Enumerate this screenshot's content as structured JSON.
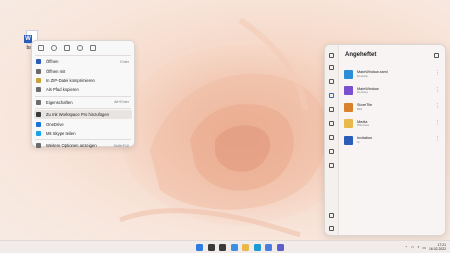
{
  "desktop": {
    "icon_label": "babo"
  },
  "context_menu": {
    "toolbar_icons": [
      "cut-icon",
      "copy-icon",
      "rename-icon",
      "share-icon",
      "delete-icon"
    ],
    "items": [
      {
        "label": "Öffnen",
        "shortcut": "Enter",
        "icon": "word-icon",
        "color": "#2b5cb8"
      },
      {
        "label": "Öffnen mit",
        "shortcut": "",
        "icon": "open-with-icon",
        "color": "#6b6b6b"
      },
      {
        "label": "In ZIP-Datei komprimieren",
        "shortcut": "",
        "icon": "zip-icon",
        "color": "#c9a23a"
      },
      {
        "label": "Als Pfad kopieren",
        "shortcut": "",
        "icon": "path-icon",
        "color": "#6b6b6b"
      },
      {
        "label": "Eigenschaften",
        "shortcut": "Alt+Enter",
        "icon": "properties-icon",
        "color": "#6b6b6b"
      },
      {
        "label": "Zu Ink Workspace Pro hinzufügen",
        "shortcut": "",
        "icon": "pen-icon",
        "color": "#3a3a3a"
      },
      {
        "label": "OneDrive",
        "shortcut": "",
        "icon": "onedrive-icon",
        "color": "#1a73d8"
      },
      {
        "label": "Mit Skype teilen",
        "shortcut": "",
        "icon": "skype-icon",
        "color": "#1aa3e8"
      },
      {
        "label": "Weitere Optionen anzeigen",
        "shortcut": "Shift+F10",
        "icon": "more-options-icon",
        "color": "#6b6b6b"
      }
    ]
  },
  "panel": {
    "title": "Angeheftet",
    "items": [
      {
        "name": "MainWindow.xaml",
        "sub": "Desktop",
        "icon": "xaml-file-icon",
        "color": "#2d8ed8"
      },
      {
        "name": "MainWindow",
        "sub": "Desktop",
        "icon": "code-file-icon",
        "color": "#7a4fd0"
      },
      {
        "name": "StoreTile",
        "sub": "Bild",
        "icon": "image-file-icon",
        "color": "#d9822b"
      },
      {
        "name": "Media",
        "sub": "Windows",
        "icon": "folder-icon",
        "color": "#e8b84a"
      },
      {
        "name": "Invitation",
        "sub": "G:",
        "icon": "word-file-icon",
        "color": "#2b5cb8"
      }
    ]
  },
  "taskbar": {
    "apps": [
      {
        "name": "start-icon",
        "color": "#2f7de0"
      },
      {
        "name": "search-icon",
        "color": "#3a3a3a"
      },
      {
        "name": "task-view-icon",
        "color": "#3a3a3a"
      },
      {
        "name": "widgets-icon",
        "color": "#3b8fe0"
      },
      {
        "name": "file-explorer-icon",
        "color": "#e8b84a"
      },
      {
        "name": "edge-icon",
        "color": "#1c9ad6"
      },
      {
        "name": "store-icon",
        "color": "#4a7de0"
      },
      {
        "name": "teams-icon",
        "color": "#5b5fc7"
      }
    ],
    "time": "17:21",
    "date": "16.02.2022"
  }
}
